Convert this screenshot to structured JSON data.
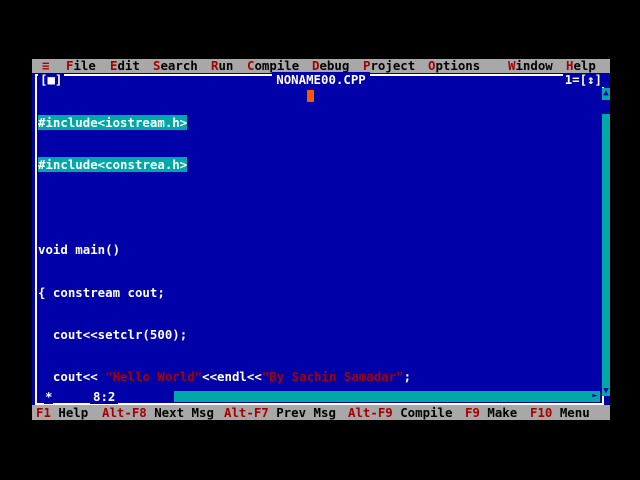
{
  "menu": {
    "system": "≡",
    "items": [
      {
        "hot": "F",
        "rest": "ile"
      },
      {
        "hot": "E",
        "rest": "dit"
      },
      {
        "hot": "S",
        "rest": "earch"
      },
      {
        "hot": "R",
        "rest": "un"
      },
      {
        "hot": "C",
        "rest": "ompile"
      },
      {
        "hot": "D",
        "rest": "ebug"
      },
      {
        "hot": "P",
        "rest": "roject"
      },
      {
        "hot": "O",
        "rest": "ptions"
      },
      {
        "hot": "W",
        "rest": "indow"
      },
      {
        "hot": "H",
        "rest": "elp"
      }
    ]
  },
  "window": {
    "close": "[■]",
    "title": "NONAME00.CPP",
    "number": "1=[↕]",
    "position": "8:2",
    "modified": "*"
  },
  "code": {
    "l1": "#include<iostream.h>",
    "l2": "#include<constrea.h>",
    "l4a": "void main()",
    "l5a": "{ constream cout;",
    "l6a": "  cout<<setclr(500);",
    "l7a": "  cout<< ",
    "l7b": "\"Hello World\"",
    "l7c": "<<endl<<",
    "l7d": "\"By Sachin Samadar\"",
    "l7e": ";",
    "l8a": "}"
  },
  "fkeys": [
    {
      "key": "F1",
      "label": " Help"
    },
    {
      "key": "Alt-F8",
      "label": " Next Msg"
    },
    {
      "key": "Alt-F7",
      "label": " Prev Msg"
    },
    {
      "key": "Alt-F9",
      "label": " Compile"
    },
    {
      "key": "F9",
      "label": " Make"
    },
    {
      "key": "F10",
      "label": " Menu"
    }
  ],
  "colors": {
    "editor_bg": "#0000a8",
    "menu_bg": "#a8a8a8",
    "hotkey": "#a80000",
    "selection": "#00a8a8",
    "cursor": "#ff5500"
  }
}
